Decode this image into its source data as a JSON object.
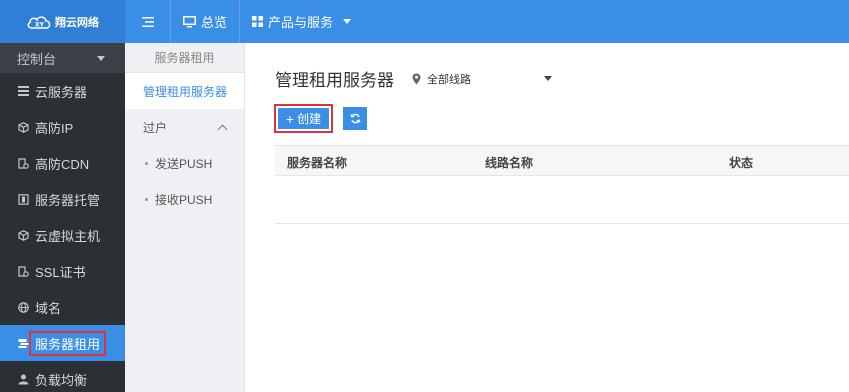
{
  "header": {
    "logo_text": "翔云网络",
    "overview_label": "总览",
    "products_label": "产品与服务"
  },
  "sidebar": {
    "console_label": "控制台",
    "items": [
      {
        "label": "云服务器",
        "icon": "server-list-icon"
      },
      {
        "label": "高防IP",
        "icon": "cube-icon"
      },
      {
        "label": "高防CDN",
        "icon": "doc-settings-icon"
      },
      {
        "label": "服务器托管",
        "icon": "hosting-icon"
      },
      {
        "label": "云虚拟主机",
        "icon": "cube-icon"
      },
      {
        "label": "SSL证书",
        "icon": "doc-settings-icon"
      },
      {
        "label": "域名",
        "icon": "globe-icon"
      },
      {
        "label": "服务器租用",
        "icon": "rent-icon"
      },
      {
        "label": "负载均衡",
        "icon": "user-icon"
      }
    ]
  },
  "subnav": {
    "header": "服务器租用",
    "active_item": "管理租用服务器",
    "group_label": "过户",
    "sub_items": [
      "发送PUSH",
      "接收PUSH"
    ]
  },
  "main": {
    "title": "管理租用服务器",
    "line_select_value": "全部线路",
    "create_label": "创建",
    "table_headers": [
      "服务器名称",
      "线路名称",
      "状态"
    ]
  },
  "colors": {
    "accent": "#3a8ee6",
    "sidebar_bg": "#2b3035",
    "highlight_border": "#e0323b"
  }
}
